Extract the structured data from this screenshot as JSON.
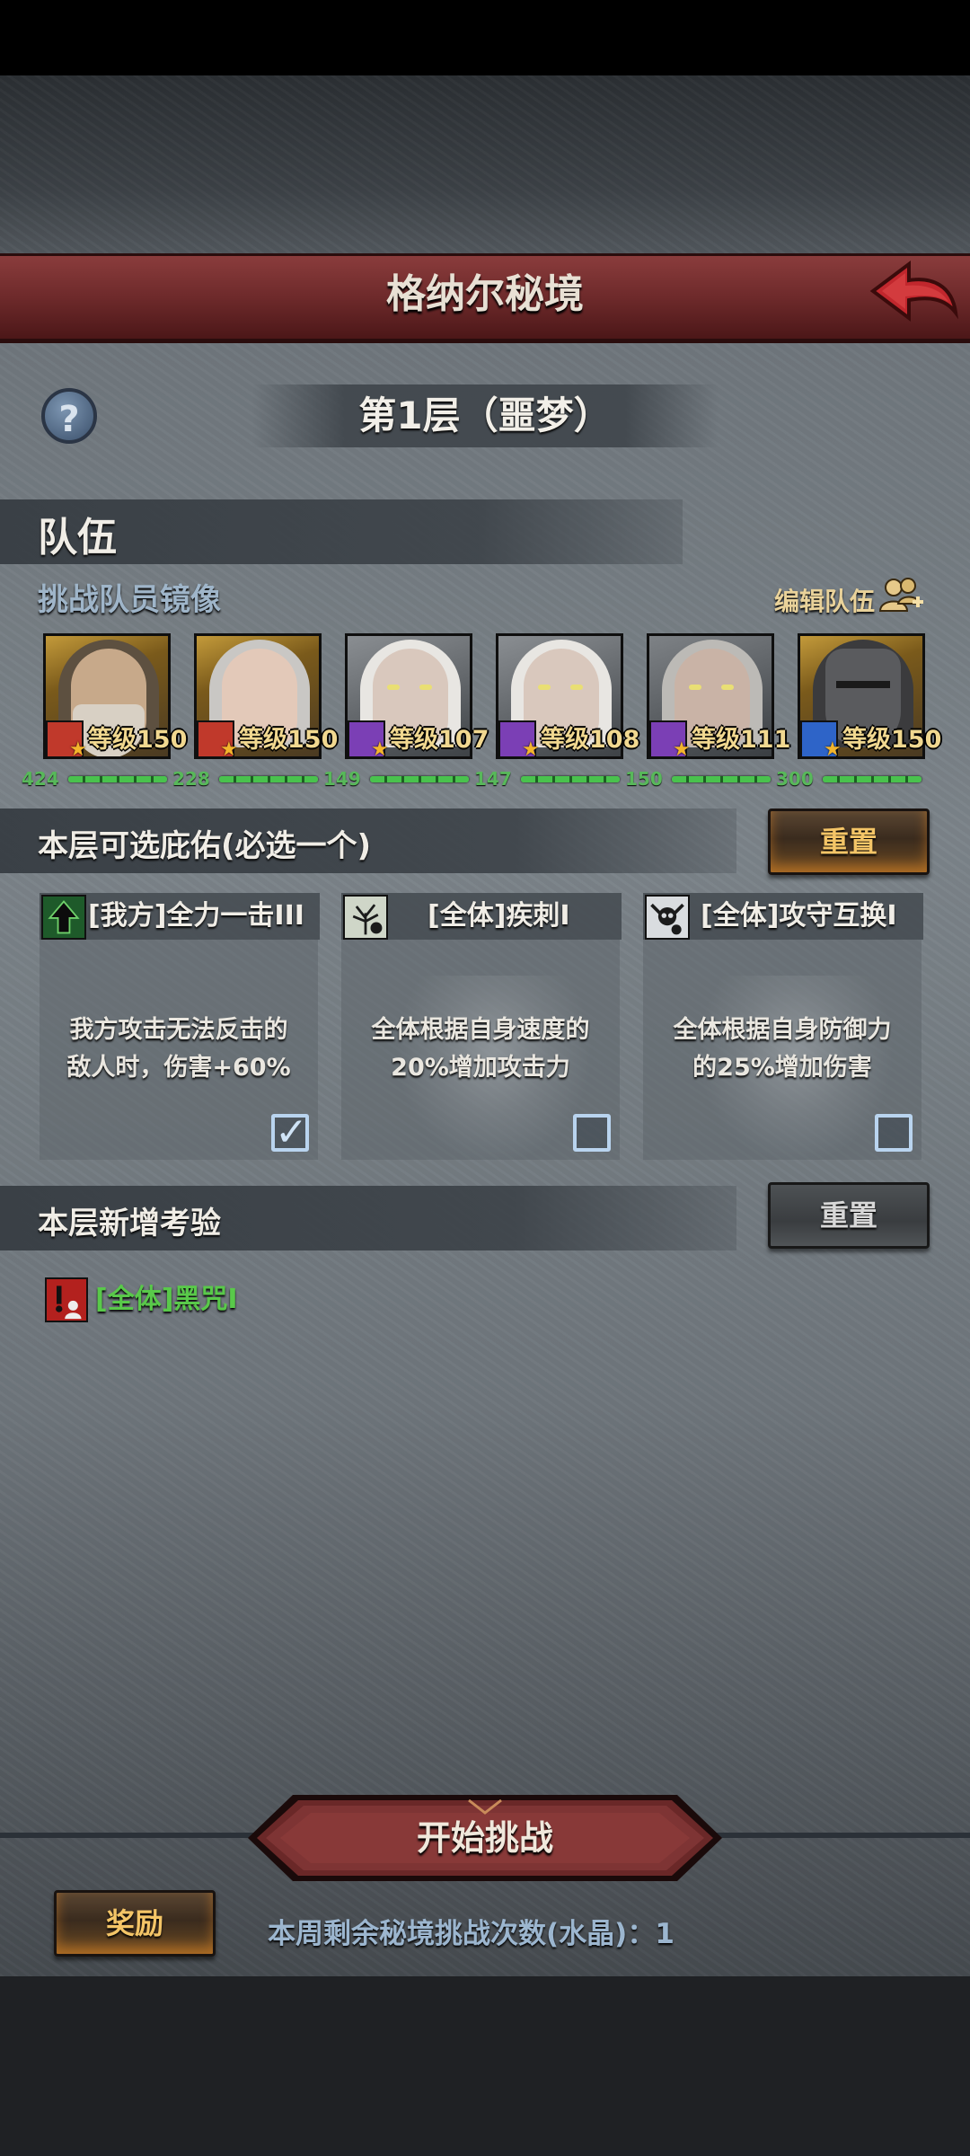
{
  "title": "格纳尔秘境",
  "floor_title": "第1层（噩梦）",
  "team": {
    "heading": "队伍",
    "subtitle": "挑战队员镜像",
    "edit_label": "编辑队伍",
    "heroes": [
      {
        "level": "等级150",
        "power": "424",
        "class_color": "#c0392b",
        "class_icon": "fist-icon"
      },
      {
        "level": "等级150",
        "power": "228",
        "class_color": "#c0392b",
        "class_icon": "fist-icon"
      },
      {
        "level": "等级107",
        "power": "149",
        "class_color": "#7b3fb5",
        "class_icon": "staff-icon"
      },
      {
        "level": "等级108",
        "power": "147",
        "class_color": "#7b3fb5",
        "class_icon": "staff-icon"
      },
      {
        "level": "等级111",
        "power": "150",
        "class_color": "#7b3fb5",
        "class_icon": "staff-icon"
      },
      {
        "level": "等级150",
        "power": "300",
        "class_color": "#2e64c8",
        "class_icon": "sword-icon"
      }
    ]
  },
  "blessings": {
    "heading": "本层可选庇佑(必选一个)",
    "reset_label": "重置",
    "cards": [
      {
        "name": "[我方]全力一击III",
        "desc_line1": "我方攻击无法反击的",
        "desc_line2": "敌人时，伤害+60%",
        "checked": true,
        "icon": "arrow-up-icon"
      },
      {
        "name": "[全体]疾刺I",
        "desc_line1": "全体根据自身速度的",
        "desc_line2": "20%增加攻击力",
        "checked": false,
        "icon": "tree-icon"
      },
      {
        "name": "[全体]攻守互换I",
        "desc_line1": "全体根据自身防御力",
        "desc_line2": "的25%增加伤害",
        "checked": false,
        "icon": "skull-icon"
      }
    ]
  },
  "trials": {
    "heading": "本层新增考验",
    "reset_label": "重置",
    "items": [
      {
        "name": "[全体]黑咒I",
        "icon": "curse-icon"
      }
    ]
  },
  "start_label": "开始挑战",
  "reward_label": "奖励",
  "weekly_text": "本周剩余秘境挑战次数(水晶)：1",
  "colors": {
    "accent_red": "#6e2a2b",
    "gold_text": "#f4c567",
    "green_text": "#59c94a",
    "blue_text": "#9cb6cf"
  }
}
